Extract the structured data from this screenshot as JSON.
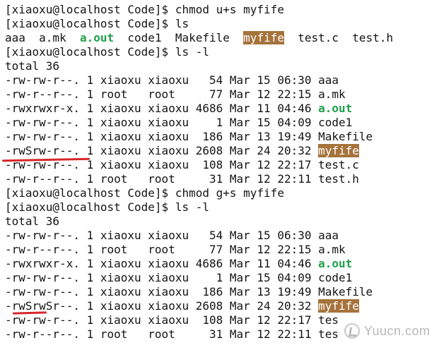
{
  "terminal": {
    "lines": [
      {
        "segments": [
          {
            "text": "[xiaoxu@localhost Code]$ chmod u+s myfife"
          }
        ]
      },
      {
        "segments": [
          {
            "text": "[xiaoxu@localhost Code]$ ls"
          }
        ]
      },
      {
        "segments": [
          {
            "text": "aaa  a.mk  "
          },
          {
            "text": "a.out",
            "style": "exec"
          },
          {
            "text": "  code1  Makefile  "
          },
          {
            "text": "myfife",
            "style": "setuid"
          },
          {
            "text": "  test.c  test.h"
          }
        ]
      },
      {
        "segments": [
          {
            "text": "[xiaoxu@localhost Code]$ ls -l"
          }
        ]
      },
      {
        "segments": [
          {
            "text": "total 36"
          }
        ]
      },
      {
        "segments": [
          {
            "text": "-rw-rw-r--. 1 xiaoxu xiaoxu   54 Mar 15 06:30 aaa"
          }
        ]
      },
      {
        "segments": [
          {
            "text": "-rw-r--r--. 1 root   root     77 Mar 12 22:15 a.mk"
          }
        ]
      },
      {
        "segments": [
          {
            "text": "-rwxrwxr-x. 1 xiaoxu xiaoxu 4686 Mar 11 04:46 "
          },
          {
            "text": "a.out",
            "style": "exec"
          }
        ]
      },
      {
        "segments": [
          {
            "text": "-rw-rw-r--. 1 xiaoxu xiaoxu    1 Mar 15 04:09 code1"
          }
        ]
      },
      {
        "segments": [
          {
            "text": "-rw-rw-r--. 1 xiaoxu xiaoxu  186 Mar 13 19:49 Makefile"
          }
        ]
      },
      {
        "segments": [
          {
            "text": "-rwSrw-r--. 1 xiaoxu xiaoxu 2608 Mar 24 20:32 "
          },
          {
            "text": "myfife",
            "style": "setuid"
          }
        ]
      },
      {
        "segments": [
          {
            "text": "-rw-rw-r--. 1 xiaoxu xiaoxu  108 Mar 12 22:17 test.c"
          }
        ]
      },
      {
        "segments": [
          {
            "text": "-rw-r--r--. 1 root   root     31 Mar 12 22:11 test.h"
          }
        ]
      },
      {
        "segments": [
          {
            "text": "[xiaoxu@localhost Code]$ chmod g+s myfife"
          }
        ]
      },
      {
        "segments": [
          {
            "text": "[xiaoxu@localhost Code]$ ls -l"
          }
        ]
      },
      {
        "segments": [
          {
            "text": "total 36"
          }
        ]
      },
      {
        "segments": [
          {
            "text": "-rw-rw-r--. 1 xiaoxu xiaoxu   54 Mar 15 06:30 aaa"
          }
        ]
      },
      {
        "segments": [
          {
            "text": "-rw-r--r--. 1 root   root     77 Mar 12 22:15 a.mk"
          }
        ]
      },
      {
        "segments": [
          {
            "text": "-rwxrwxr-x. 1 xiaoxu xiaoxu 4686 Mar 11 04:46 "
          },
          {
            "text": "a.out",
            "style": "exec"
          }
        ]
      },
      {
        "segments": [
          {
            "text": "-rw-rw-r--. 1 xiaoxu xiaoxu    1 Mar 15 04:09 code1"
          }
        ]
      },
      {
        "segments": [
          {
            "text": "-rw-rw-r--. 1 xiaoxu xiaoxu  186 Mar 13 19:49 Makefile"
          }
        ]
      },
      {
        "segments": [
          {
            "text": "-rwSrwSr--. 1 xiaoxu xiaoxu 2608 Mar 24 20:32 "
          },
          {
            "text": "myfife",
            "style": "setuid"
          }
        ]
      },
      {
        "segments": [
          {
            "text": "-rw-rw-r--. 1 xiaoxu xiaoxu  108 Mar 12 22:17 tes"
          }
        ]
      },
      {
        "segments": [
          {
            "text": "-rw-r--r--. 1 root   root     31 Mar 12 22:11 tes"
          }
        ]
      }
    ]
  },
  "watermark": {
    "text": "Yuucn.com",
    "icon": "yuucn-logo-icon"
  },
  "colors": {
    "background": "#ffffff",
    "text": "#141414",
    "exec_green": "#1fa14a",
    "setuid_highlight": "#a6733c",
    "annotation_red": "#d7262a",
    "watermark_gray": "#b8b8b8"
  }
}
